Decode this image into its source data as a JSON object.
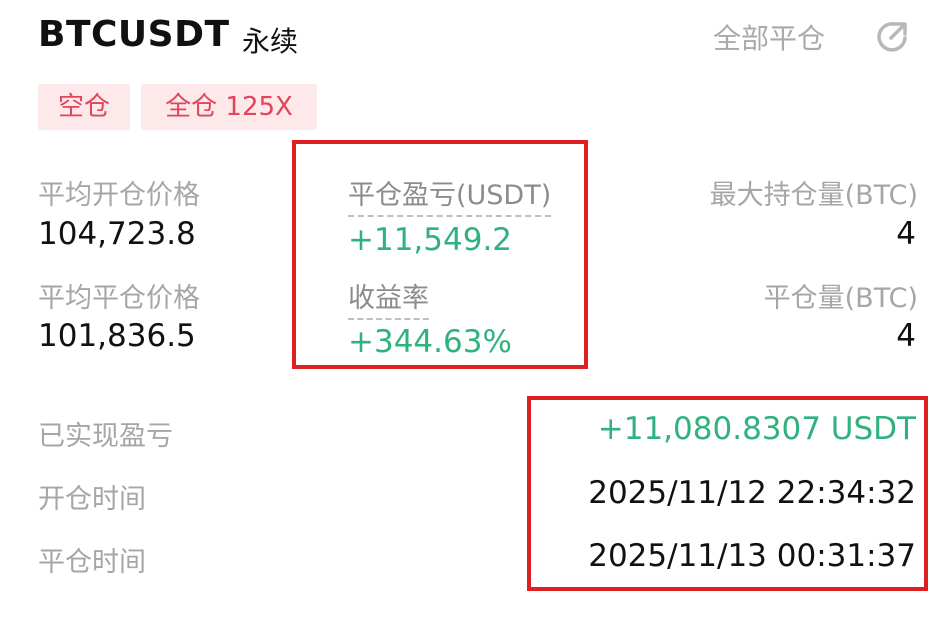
{
  "header": {
    "symbol": "BTCUSDT",
    "contract_type": "永续",
    "close_all_label": "全部平仓",
    "share_icon": "share-icon"
  },
  "tags": {
    "side": "空仓",
    "margin_leverage": "全仓 125X"
  },
  "stats": {
    "avg_open_price_label": "平均开仓价格",
    "avg_open_price_value": "104,723.8",
    "avg_close_price_label": "平均平仓价格",
    "avg_close_price_value": "101,836.5",
    "close_pnl_label": "平仓盈亏(USDT)",
    "close_pnl_value": "+11,549.2",
    "roi_label": "收益率",
    "roi_value": "+344.63%",
    "max_position_label": "最大持仓量(BTC)",
    "max_position_value": "4",
    "close_volume_label": "平仓量(BTC)",
    "close_volume_value": "4"
  },
  "details": {
    "realized_pnl_label": "已实现盈亏",
    "realized_pnl_value": "+11,080.8307 USDT",
    "open_time_label": "开仓时间",
    "open_time_value": "2025/11/12 22:34:32",
    "close_time_label": "平仓时间",
    "close_time_value": "2025/11/13 00:31:37"
  },
  "colors": {
    "profit_green": "#2fb27f",
    "tag_bg": "#fde8ea",
    "tag_text": "#e0465a",
    "highlight_red": "#e02020",
    "muted_text": "#a6a6a6"
  }
}
